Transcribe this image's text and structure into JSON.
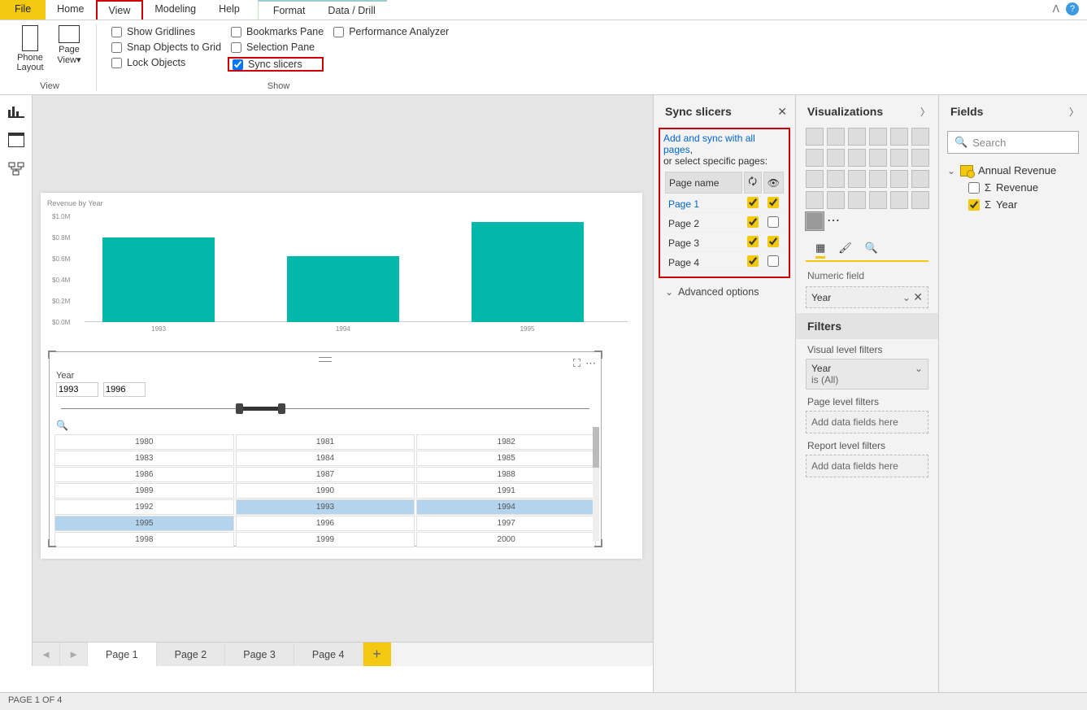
{
  "ribbon": {
    "tabs": [
      "File",
      "Home",
      "View",
      "Modeling",
      "Help"
    ],
    "contextTabs": [
      "Format",
      "Data / Drill"
    ],
    "phone": "Phone\nLayout",
    "pageview": "Page\nView",
    "viewGroup": "View",
    "showGroup": "Show",
    "checks": {
      "gridlines": "Show Gridlines",
      "snap": "Snap Objects to Grid",
      "lock": "Lock Objects",
      "bookmarks": "Bookmarks Pane",
      "selection": "Selection Pane",
      "sync": "Sync slicers",
      "perf": "Performance Analyzer"
    }
  },
  "pages": {
    "list": [
      "Page 1",
      "Page 2",
      "Page 3",
      "Page 4"
    ],
    "active": 0
  },
  "status": "PAGE 1 OF 4",
  "chart_data": {
    "type": "bar",
    "title": "Revenue by Year",
    "categories": [
      "1993",
      "1994",
      "1995"
    ],
    "values": [
      0.8,
      0.62,
      0.95
    ],
    "yticks": [
      "$0.0M",
      "$0.2M",
      "$0.4M",
      "$0.6M",
      "$0.8M",
      "$1.0M"
    ],
    "ylim": [
      0,
      1.0
    ]
  },
  "slicer": {
    "field": "Year",
    "from": "1993",
    "to": "1996",
    "years": [
      [
        "1980",
        "1981",
        "1982"
      ],
      [
        "1983",
        "1984",
        "1985"
      ],
      [
        "1986",
        "1987",
        "1988"
      ],
      [
        "1989",
        "1990",
        "1991"
      ],
      [
        "1992",
        "1993",
        "1994"
      ],
      [
        "1995",
        "1996",
        "1997"
      ],
      [
        "1998",
        "1999",
        "2000"
      ]
    ],
    "selected": [
      "1993",
      "1994",
      "1995"
    ]
  },
  "syncPane": {
    "title": "Sync slicers",
    "linkText": "Add and sync with all pages",
    "orText": "or select specific pages:",
    "colPage": "Page name",
    "rows": [
      {
        "name": "Page 1",
        "sync": true,
        "visible": true
      },
      {
        "name": "Page 2",
        "sync": true,
        "visible": false
      },
      {
        "name": "Page 3",
        "sync": true,
        "visible": true
      },
      {
        "name": "Page 4",
        "sync": true,
        "visible": false
      }
    ],
    "advanced": "Advanced options"
  },
  "viz": {
    "title": "Visualizations",
    "numericField": "Numeric field",
    "fieldName": "Year",
    "filtersTitle": "Filters",
    "visualFilters": "Visual level filters",
    "filterField": "Year",
    "filterVal": "is (All)",
    "pageFilters": "Page level filters",
    "reportFilters": "Report level filters",
    "addFields": "Add data fields here"
  },
  "fields": {
    "title": "Fields",
    "searchPlaceholder": "Search",
    "table": "Annual Revenue",
    "cols": [
      {
        "name": "Revenue",
        "checked": false
      },
      {
        "name": "Year",
        "checked": true
      }
    ]
  }
}
